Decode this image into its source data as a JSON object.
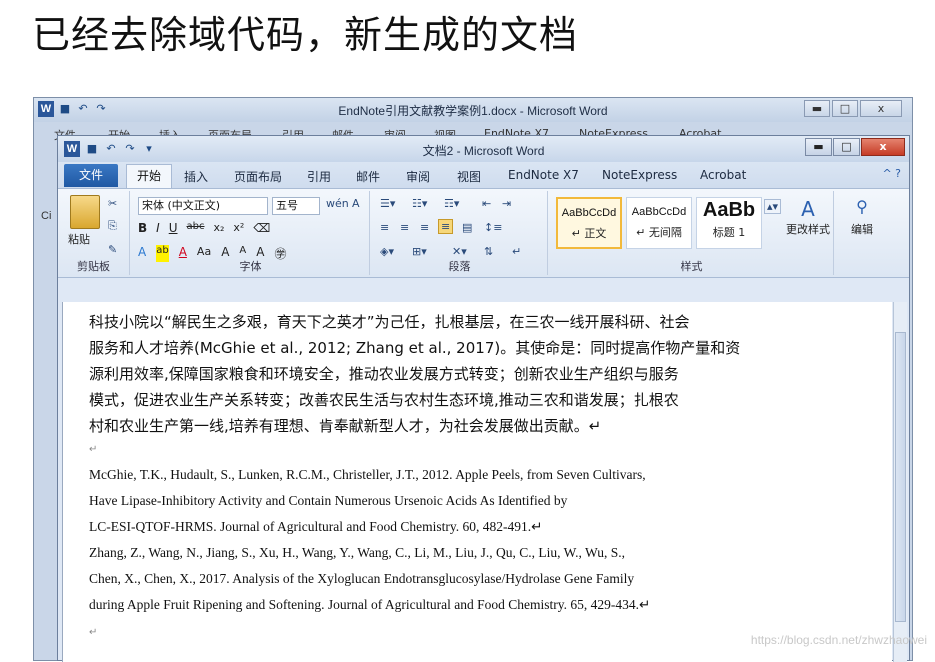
{
  "slide": {
    "title": "已经去除域代码，新生成的文档"
  },
  "back_window": {
    "title": "EndNote引用文献教学案例1.docx - Microsoft Word",
    "tabs": [
      "文件",
      "开始",
      "插入",
      "页面布局",
      "引用",
      "邮件",
      "审阅",
      "视图",
      "EndNote X7",
      "NoteExpress",
      "Acrobat"
    ],
    "side_text": "Ci"
  },
  "window": {
    "title": "文档2 - Microsoft Word",
    "controls": {
      "minimize": "▬",
      "maximize": "□",
      "close": "x"
    }
  },
  "ribbon_tabs": {
    "file": "文件",
    "active": "开始",
    "others": [
      "插入",
      "页面布局",
      "引用",
      "邮件",
      "审阅",
      "视图",
      "EndNote X7",
      "NoteExpress",
      "Acrobat"
    ]
  },
  "ribbon": {
    "clipboard": {
      "paste_label": "粘贴",
      "group_label": "剪贴板"
    },
    "font": {
      "font_name": "宋体 (中文正文)",
      "font_size": "五号",
      "group_label": "字体"
    },
    "paragraph": {
      "group_label": "段落"
    },
    "styles": {
      "cards": [
        {
          "sample": "AaBbCcDd",
          "name": "↵ 正文"
        },
        {
          "sample": "AaBbCcDd",
          "name": "↵ 无间隔"
        },
        {
          "sample": "AaBb",
          "name": "标题 1"
        }
      ],
      "change_styles": "更改样式",
      "group_label": "样式"
    },
    "editing": {
      "label": "编辑"
    }
  },
  "document": {
    "chinese_lines": [
      "科技小院以“解民生之多艰，育天下之英才”为己任，扎根基层，在三农一线开展科研、社会",
      "服务和人才培养(McGhie et al., 2012; Zhang et al., 2017)。其使命是：同时提高作物产量和资",
      "源利用效率,保障国家粮食和环境安全，推动农业发展方式转变；创新农业生产组织与服务",
      "模式，促进农业生产关系转变；改善农民生活与农村生态环境,推动三农和谐发展；扎根农",
      "村和农业生产第一线,培养有理想、肯奉献新型人才，为社会发展做出贡献。↵"
    ],
    "para_mark": "↵",
    "references": [
      "McGhie, T.K., Hudault, S., Lunken, R.C.M., Christeller, J.T., 2012. Apple Peels, from Seven Cultivars,",
      "Have  Lipase-Inhibitory  Activity  and  Contain  Numerous  Ursenoic  Acids  As  Identified  by",
      "LC-ESI-QTOF-HRMS.  Journal of Agricultural and Food Chemistry. 60, 482-491.↵",
      "Zhang, Z., Wang, N., Jiang, S., Xu, H., Wang, Y., Wang, C., Li, M., Liu, J., Qu, C., Liu, W., Wu, S.,",
      "Chen, X., Chen, X., 2017. Analysis of the Xyloglucan Endotransglucosylase/Hydrolase Gene Family",
      "during Apple Fruit Ripening and Softening. Journal of Agricultural and Food Chemistry. 65, 429-434.↵"
    ]
  },
  "watermark": "https://blog.csdn.net/zhwzhaowei"
}
